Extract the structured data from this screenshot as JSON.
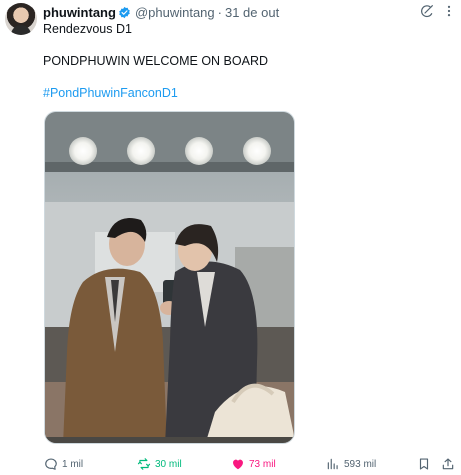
{
  "author": {
    "display_name": "phuwintang",
    "handle": "@phuwintang",
    "separator": "·",
    "date": "31 de out"
  },
  "tweet": {
    "subtitle": "Rendezvous D1",
    "text": "PONDPHUWIN WELCOME ON BOARD",
    "hashtag": "#PondPhuwinFanconD1"
  },
  "actions": {
    "replies": "1 mil",
    "reposts": "30 mil",
    "likes": "73 mil",
    "views": "593 mil"
  },
  "colors": {
    "link": "#1d9bf0",
    "repost": "#00ba7c",
    "like": "#f91880",
    "muted": "#536471",
    "verified": "#1d9bf0"
  },
  "icons": [
    "verified-badge-icon",
    "grok-icon",
    "more-icon",
    "reply-icon",
    "repost-icon",
    "like-icon",
    "views-icon",
    "bookmark-icon",
    "share-icon"
  ]
}
